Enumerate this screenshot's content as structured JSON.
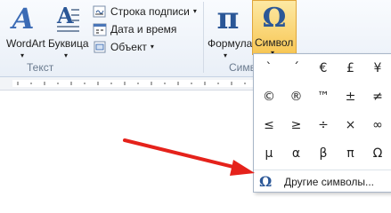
{
  "ribbon": {
    "wordart_label": "WordArt",
    "bukvica_label": "Буквица",
    "signature_line_label": "Строка подписи",
    "datetime_label": "Дата и время",
    "object_label": "Объект",
    "group_text_label": "Текст",
    "formula_label": "Формула",
    "symbol_label": "Символ",
    "group_symbols_label": "Симв",
    "pi_glyph": "π",
    "omega_glyph": "Ω",
    "wordart_glyph": "A"
  },
  "symbols": {
    "grid": [
      [
        "ˋ",
        "´",
        "€",
        "£",
        "¥"
      ],
      [
        "©",
        "®",
        "™",
        "±",
        "≠"
      ],
      [
        "≤",
        "≥",
        "÷",
        "×",
        "∞"
      ],
      [
        "µ",
        "α",
        "β",
        "π",
        "Ω"
      ]
    ],
    "more_label": "Другие символы...",
    "more_glyph": "Ω"
  },
  "colors": {
    "highlight": "#f7c653",
    "arrow": "#e5221b",
    "accent_blue": "#2b5797"
  }
}
